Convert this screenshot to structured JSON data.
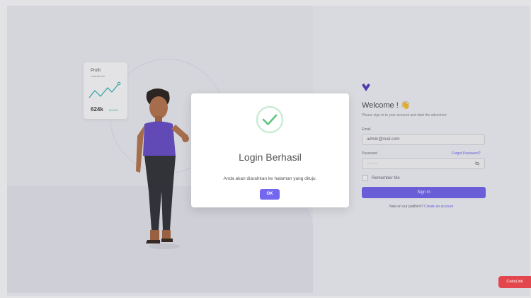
{
  "profit_card": {
    "title": "Profit",
    "subtitle": "Last Month",
    "value": "624k",
    "change": "+8.24%"
  },
  "login": {
    "welcome": "Welcome ! 👋",
    "subtitle": "Please sign-in to your account and start the adventure",
    "email_label": "Email",
    "email_value": "admin@mail.com",
    "password_label": "Password",
    "forgot_password": "Forgot Password?",
    "password_value": "········",
    "remember_me": "Remember Me",
    "sign_in": "Sign in",
    "new_text": "New on our platform?",
    "create_account": "Create an account"
  },
  "modal": {
    "title": "Login Berhasil",
    "message": "Anda akan diarahkan ke halaman yang dituju.",
    "ok_label": "OK"
  },
  "badge": {
    "label": "CodeLink"
  },
  "colors": {
    "primary": "#7367f0",
    "success": "#28c76f",
    "badge": "#e3474d"
  },
  "icons": {
    "logo": "brand-heart-logo",
    "success": "check-circle",
    "password_toggle": "eye-off",
    "chart": "line-chart"
  }
}
